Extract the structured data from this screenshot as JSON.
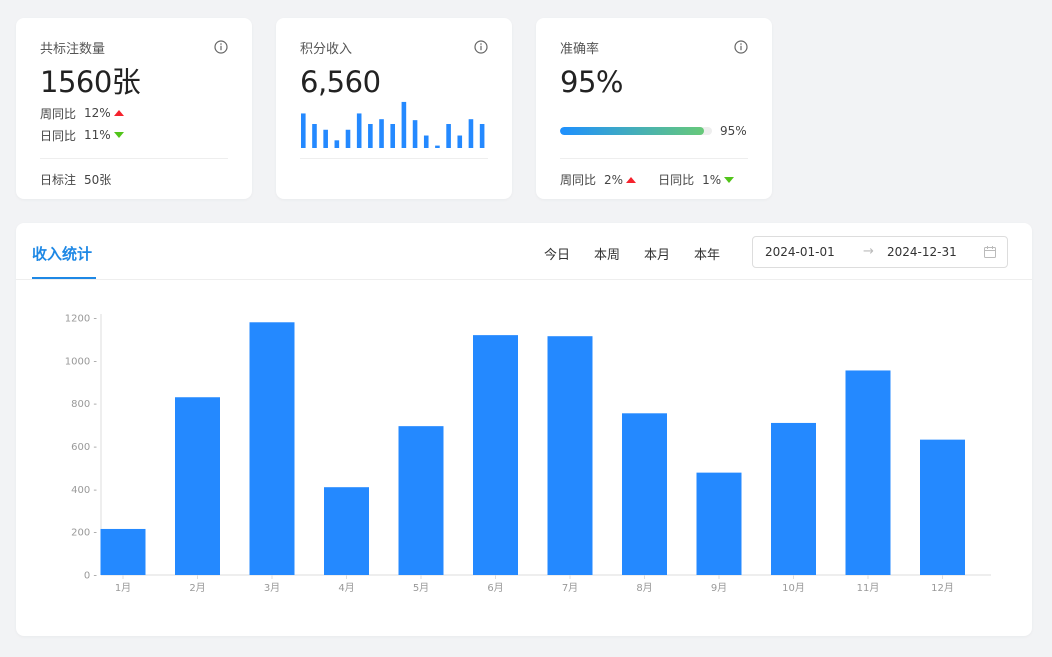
{
  "cards": [
    {
      "title": "共标注数量",
      "value": "1560张",
      "trends": [
        {
          "label": "周同比",
          "value": "12%",
          "direction": "up"
        },
        {
          "label": "日同比",
          "value": "11%",
          "direction": "down"
        }
      ],
      "footer_label": "日标注",
      "footer_value": "50张"
    },
    {
      "title": "积分收入",
      "value": "6,560",
      "mini_bars": [
        0.72,
        0.5,
        0.38,
        0.16,
        0.38,
        0.72,
        0.5,
        0.6,
        0.5,
        0.96,
        0.58,
        0.26,
        0.05,
        0.5,
        0.26,
        0.6,
        0.5
      ]
    },
    {
      "title": "准确率",
      "value": "95%",
      "progress": 0.95,
      "progress_label": "95%",
      "trends": [
        {
          "label": "周同比",
          "value": "2%",
          "direction": "up"
        },
        {
          "label": "日同比",
          "value": "1%",
          "direction": "down"
        }
      ]
    }
  ],
  "main": {
    "tab": "收入统计",
    "ranges": [
      "今日",
      "本周",
      "本月",
      "本年"
    ],
    "date_start": "2024-01-01",
    "date_arrow": "→",
    "date_end": "2024-12-31"
  },
  "colors": {
    "accent": "#1e88e5",
    "bar": "#2489ff",
    "up": "#f5222d",
    "down": "#52c41a"
  },
  "chart_data": {
    "type": "bar",
    "categories": [
      "1月",
      "2月",
      "3月",
      "4月",
      "5月",
      "6月",
      "7月",
      "8月",
      "9月",
      "10月",
      "11月",
      "12月"
    ],
    "values": [
      215,
      830,
      1180,
      410,
      695,
      1120,
      1115,
      755,
      478,
      710,
      955,
      632
    ],
    "ylim": [
      0,
      1200
    ],
    "yticks": [
      0,
      200,
      400,
      600,
      800,
      1000,
      1200
    ],
    "grid": false,
    "legend": "none"
  }
}
